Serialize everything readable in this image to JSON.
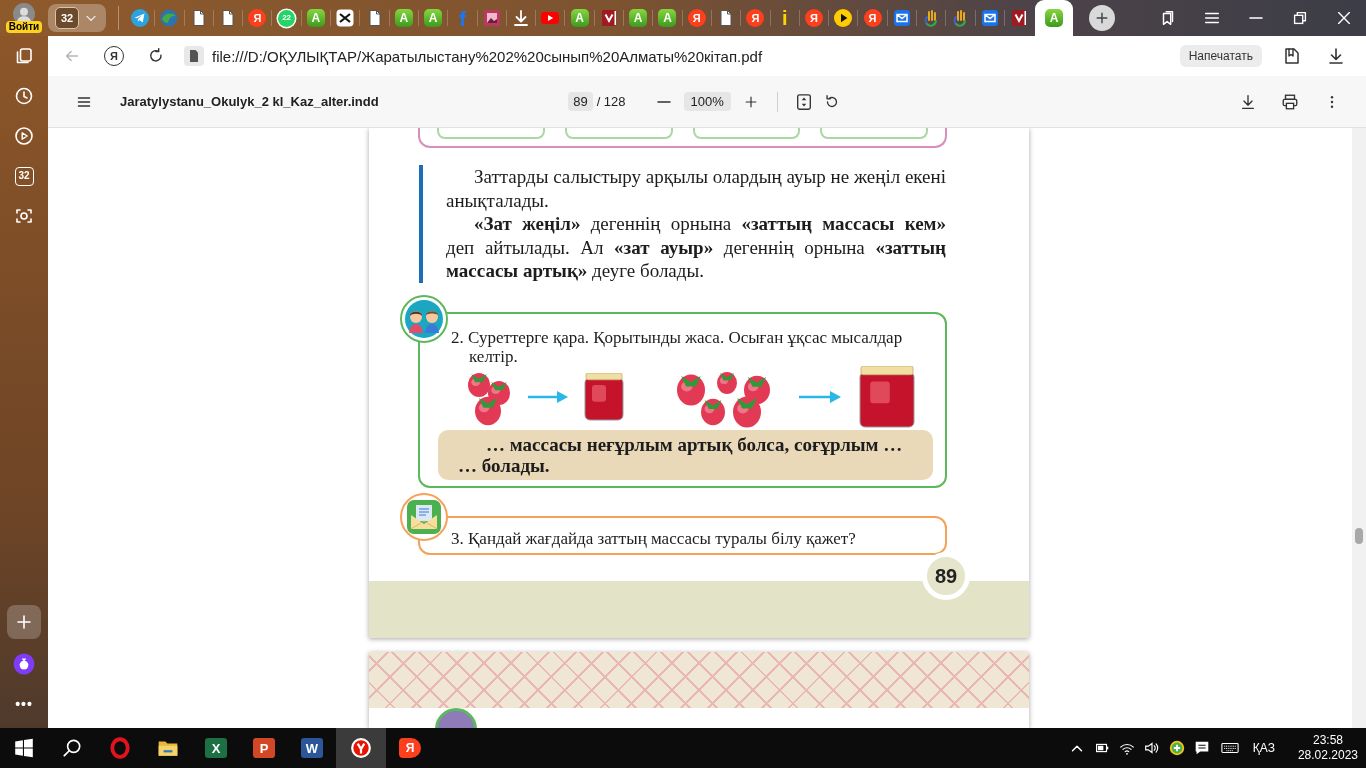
{
  "browser": {
    "profile_label": "Войти",
    "tab_count": "32",
    "tabs": [
      {
        "kind": "telegram",
        "selected": false
      },
      {
        "kind": "globe",
        "selected": false
      },
      {
        "kind": "document",
        "selected": false
      },
      {
        "kind": "document",
        "selected": false
      },
      {
        "kind": "yandex",
        "glyph": "Я",
        "selected": false
      },
      {
        "kind": "counter",
        "glyph": "22",
        "selected": false
      },
      {
        "kind": "app",
        "glyph": "A",
        "selected": false
      },
      {
        "kind": "cut",
        "selected": false
      },
      {
        "kind": "document",
        "selected": false
      },
      {
        "kind": "app",
        "glyph": "A",
        "selected": false
      },
      {
        "kind": "app",
        "glyph": "A",
        "selected": false
      },
      {
        "kind": "letter_f",
        "glyph": "f",
        "selected": false
      },
      {
        "kind": "image",
        "selected": false
      },
      {
        "kind": "download",
        "selected": false
      },
      {
        "kind": "video",
        "selected": false
      },
      {
        "kind": "app",
        "glyph": "A",
        "selected": false
      },
      {
        "kind": "shield",
        "selected": false
      },
      {
        "kind": "app",
        "glyph": "A",
        "selected": false
      },
      {
        "kind": "app",
        "glyph": "A",
        "selected": false
      },
      {
        "kind": "yandex",
        "glyph": "Я",
        "selected": false
      },
      {
        "kind": "document",
        "selected": false
      },
      {
        "kind": "yandex",
        "glyph": "Я",
        "selected": false
      },
      {
        "kind": "info",
        "glyph": "i",
        "selected": false
      },
      {
        "kind": "yandex",
        "glyph": "Я",
        "selected": false
      },
      {
        "kind": "play",
        "selected": false
      },
      {
        "kind": "yandex",
        "glyph": "Я",
        "selected": false
      },
      {
        "kind": "mail",
        "selected": false
      },
      {
        "kind": "hand",
        "selected": false
      },
      {
        "kind": "hand",
        "selected": false
      },
      {
        "kind": "mail",
        "selected": false
      },
      {
        "kind": "shield",
        "selected": false
      },
      {
        "kind": "app",
        "glyph": "A",
        "selected": true
      }
    ],
    "sidebar": [
      {
        "kind": "collections"
      },
      {
        "kind": "history"
      },
      {
        "kind": "video"
      },
      {
        "kind": "counter",
        "glyph": "32"
      },
      {
        "kind": "screenshot"
      }
    ],
    "sidebar_bottom": [
      {
        "kind": "add"
      },
      {
        "kind": "assistant"
      },
      {
        "kind": "more",
        "glyph": "•••"
      }
    ],
    "navigation": {
      "back_disabled": true,
      "home_glyph": "Я"
    },
    "url": "file:///D:/ОҚУЛЫҚТАР/Жаратылыстану%202%20сынып%20Алматы%20кітап.pdf",
    "print_label": "Напечатать"
  },
  "pdf_toolbar": {
    "title": "Jaratylystanu_Okulyk_2 kl_Kaz_alter.indd",
    "page": "89",
    "page_total": "/ 128",
    "zoom": "100%"
  },
  "document": {
    "paragraphs": [
      "Заттарды салыстыру арқылы олардың ауыр не жеңіл екені анықталады.",
      "**«Зат жеңіл»** дегеннің орнына **«заттың массасы кем»** деп айтылады. Ал **«зат ауыр»** дегеннің орнына **«заттың массасы артық»** деуге болады."
    ],
    "exercises": [
      {
        "kind": "pictures",
        "text": "2. Суреттерге қара. Қорытынды жаса. Осыған ұқсас мысалдар келтір.",
        "fill_text": "… массасы неғұрлым артық болса, соғұрлым … … болады."
      },
      {
        "kind": "question",
        "text": "3. Қандай жағдайда заттың массасы туралы білу қажет?"
      }
    ],
    "page_number": "89"
  },
  "taskbar": {
    "apps": [
      {
        "kind": "start",
        "selected": false
      },
      {
        "kind": "search",
        "selected": false
      },
      {
        "kind": "opera",
        "selected": false
      },
      {
        "kind": "folder",
        "selected": false
      },
      {
        "kind": "sheet",
        "glyph": "X",
        "selected": false
      },
      {
        "kind": "slides",
        "glyph": "P",
        "selected": false
      },
      {
        "kind": "word",
        "glyph": "W",
        "selected": false
      },
      {
        "kind": "browser",
        "selected": true
      },
      {
        "kind": "yandex",
        "glyph": "Я",
        "selected": false
      }
    ],
    "language": "ҚАЗ",
    "time": "23:58",
    "date": "28.02.2023"
  }
}
